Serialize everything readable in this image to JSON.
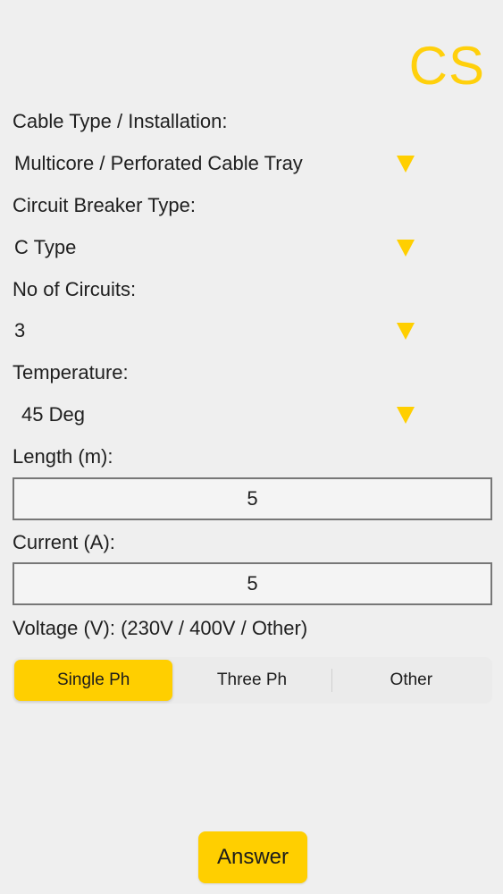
{
  "app": {
    "logo_text": "CS"
  },
  "colors": {
    "accent": "#ffcf00",
    "background": "#efefef"
  },
  "form": {
    "cable_type": {
      "label": "Cable Type / Installation:",
      "value": "Multicore / Perforated Cable Tray",
      "icon": "dropdown-triangle-icon"
    },
    "breaker_type": {
      "label": "Circuit Breaker Type:",
      "value": "C Type",
      "icon": "dropdown-triangle-icon"
    },
    "circuits": {
      "label": "No of Circuits:",
      "value": "3",
      "icon": "dropdown-triangle-icon"
    },
    "temperature": {
      "label": "Temperature:",
      "value": "45 Deg",
      "icon": "dropdown-triangle-icon"
    },
    "length": {
      "label": "Length (m):",
      "value": "5"
    },
    "current": {
      "label": "Current (A):",
      "value": "5"
    },
    "voltage": {
      "label": "Voltage (V): (230V / 400V / Other)",
      "options": [
        "Single Ph",
        "Three Ph",
        "Other"
      ],
      "selected": "Single Ph"
    }
  },
  "actions": {
    "answer_label": "Answer"
  }
}
